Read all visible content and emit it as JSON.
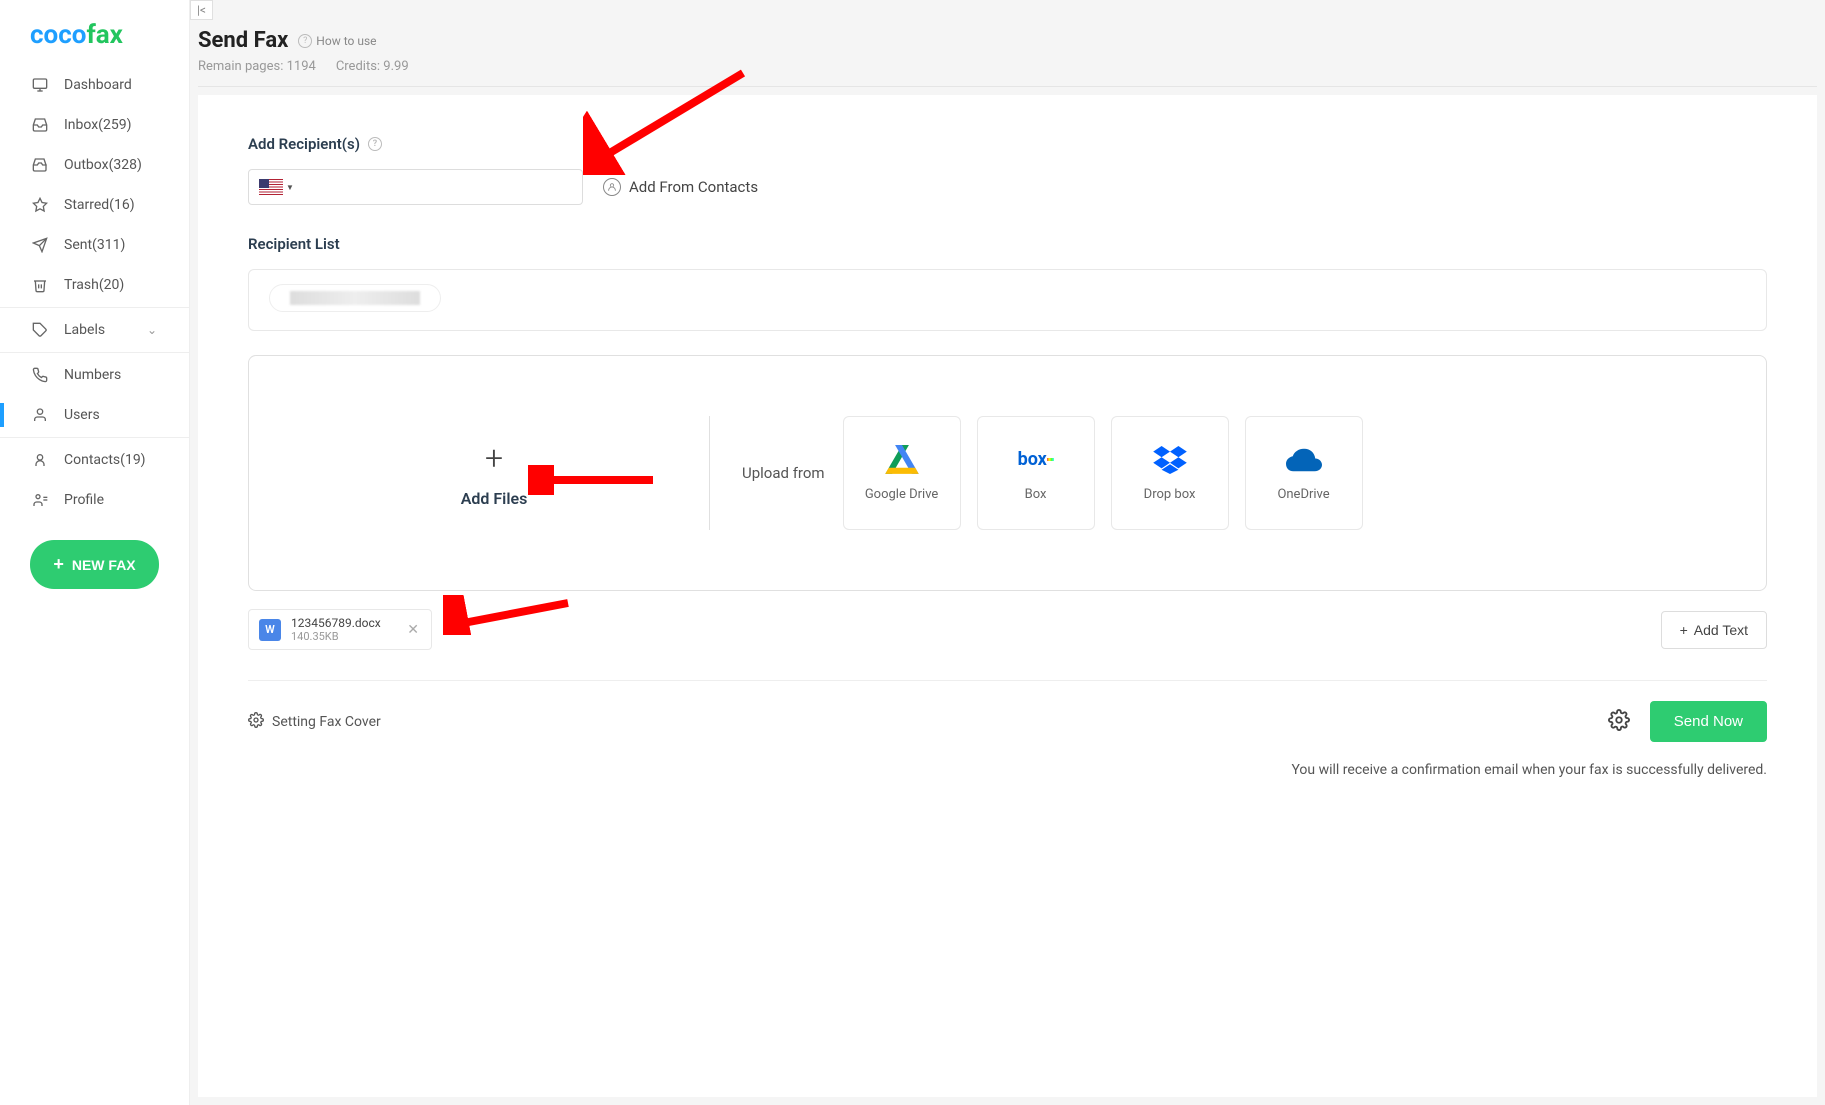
{
  "logo": {
    "part1": "coco",
    "part2": "fax"
  },
  "sidebar": {
    "items": [
      {
        "label": "Dashboard"
      },
      {
        "label": "Inbox(259)"
      },
      {
        "label": "Outbox(328)"
      },
      {
        "label": "Starred(16)"
      },
      {
        "label": "Sent(311)"
      },
      {
        "label": "Trash(20)"
      }
    ],
    "labels_label": "Labels",
    "numbers_label": "Numbers",
    "users_label": "Users",
    "contacts_label": "Contacts(19)",
    "profile_label": "Profile",
    "new_fax_label": "NEW FAX"
  },
  "header": {
    "title": "Send Fax",
    "how_to_use": "How to use",
    "remain_pages": "Remain pages: 1194",
    "credits": "Credits: 9.99"
  },
  "recipients": {
    "label": "Add Recipient(s)",
    "placeholder": "",
    "add_from_contacts": "Add From Contacts",
    "list_label": "Recipient List"
  },
  "upload": {
    "add_files": "Add Files",
    "upload_from": "Upload from",
    "providers": [
      {
        "label": "Google Drive"
      },
      {
        "label": "Box"
      },
      {
        "label": "Drop box"
      },
      {
        "label": "OneDrive"
      }
    ]
  },
  "files": [
    {
      "name": "123456789.docx",
      "size": "140.35KB"
    }
  ],
  "add_text_label": "Add Text",
  "fax_cover_label": "Setting Fax Cover",
  "send_label": "Send Now",
  "confirm_note": "You will receive a confirmation email when your fax is successfully delivered."
}
